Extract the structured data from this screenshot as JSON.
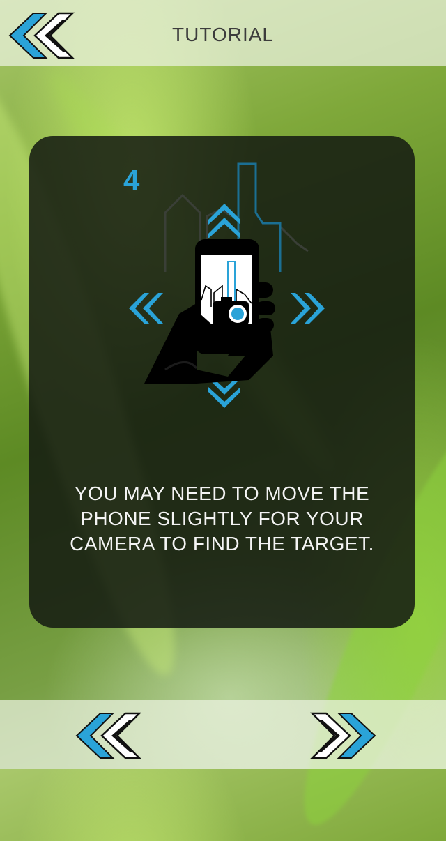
{
  "header": {
    "title": "TUTORIAL",
    "back_icon": "double-chevron-left-icon"
  },
  "tutorial": {
    "step_number": "4",
    "illustration_icon": "hand-holding-phone-camera-icon",
    "instruction": "YOU MAY NEED TO MOVE THE\nPHONE SLIGHTLY FOR YOUR\nCAMERA TO FIND THE TARGET."
  },
  "footer": {
    "prev_icon": "double-chevron-left-icon",
    "next_icon": "double-chevron-right-icon"
  },
  "colors": {
    "accent_blue": "#2aa3d8",
    "card_background": "#141a12",
    "title_text": "#3c3c3c",
    "instruction_text": "#f4f4f4"
  }
}
